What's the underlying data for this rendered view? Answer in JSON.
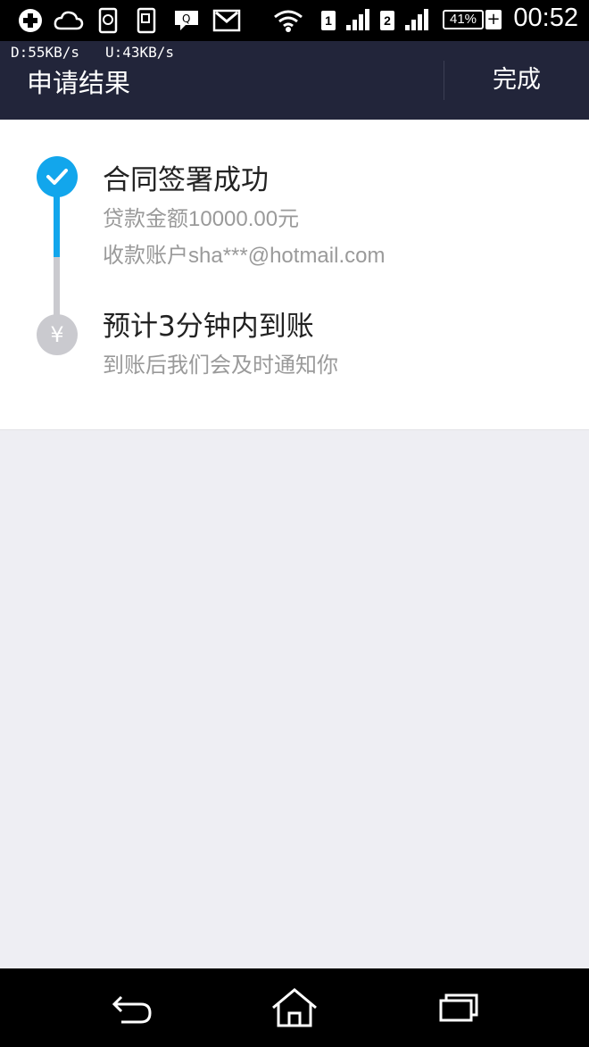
{
  "status_bar": {
    "battery_percent": "41%",
    "battery_plus": "+",
    "time": "00:52",
    "sim1": "1",
    "sim2": "2"
  },
  "header": {
    "net_speed": "D:55KB/s   U:43KB/s",
    "title": "申请结果",
    "done_label": "完成"
  },
  "steps": [
    {
      "title": "合同签署成功",
      "detail1": "贷款金额10000.00元",
      "detail2": "收款账户sha***@hotmail.com",
      "icon": "check-icon",
      "color": "#12a6ec"
    },
    {
      "title": "预计3分钟内到账",
      "detail1": "到账后我们会及时通知你",
      "icon_text": "¥",
      "color": "#cacacf"
    }
  ]
}
